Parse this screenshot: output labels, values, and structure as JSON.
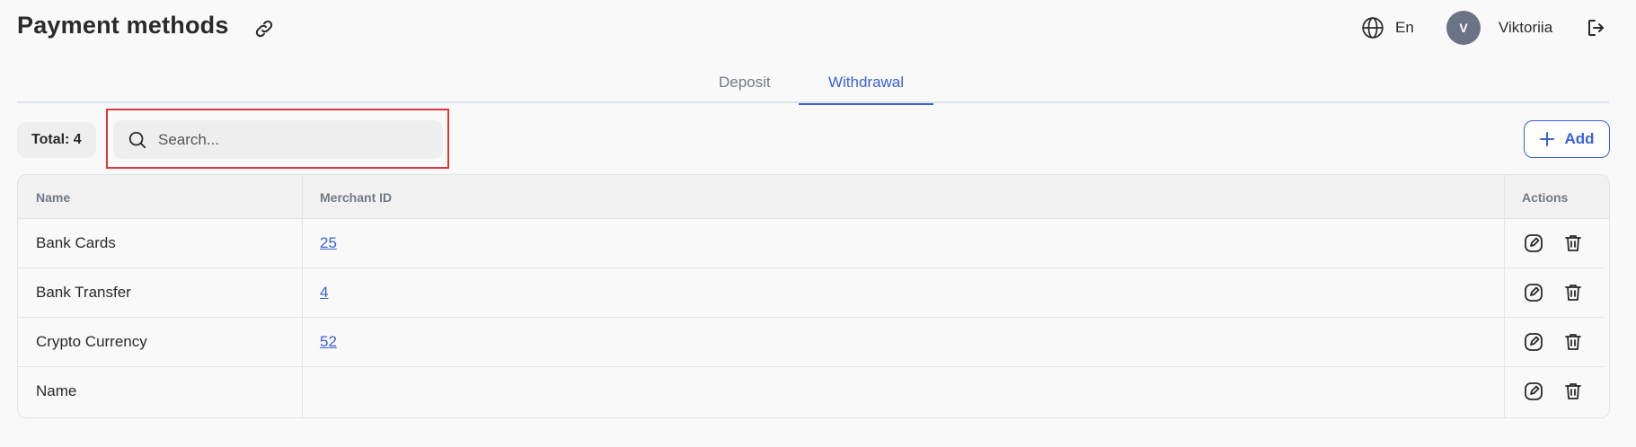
{
  "header": {
    "title": "Payment methods",
    "language": "En",
    "avatar_initial": "V",
    "username": "Viktoriia"
  },
  "tabs": [
    {
      "label": "Deposit",
      "active": false
    },
    {
      "label": "Withdrawal",
      "active": true
    }
  ],
  "toolbar": {
    "total_label": "Total: 4",
    "search_placeholder": "Search...",
    "add_label": "Add"
  },
  "table": {
    "columns": [
      "Name",
      "Merchant ID",
      "Actions"
    ],
    "rows": [
      {
        "name": "Bank Cards",
        "merchant_id": "25"
      },
      {
        "name": "Bank Transfer",
        "merchant_id": "4"
      },
      {
        "name": "Crypto Currency",
        "merchant_id": "52"
      },
      {
        "name": "Name",
        "merchant_id": ""
      }
    ]
  },
  "icons": {
    "title_link": "link-icon",
    "language": "globe-icon",
    "logout": "logout-icon",
    "search": "search-icon",
    "add": "plus-icon",
    "edit": "edit-icon",
    "delete": "trash-icon"
  },
  "colors": {
    "accent": "#3b62d6",
    "background": "#f9f9f9",
    "highlight": "#e0363b",
    "avatar": "#6b7386"
  }
}
